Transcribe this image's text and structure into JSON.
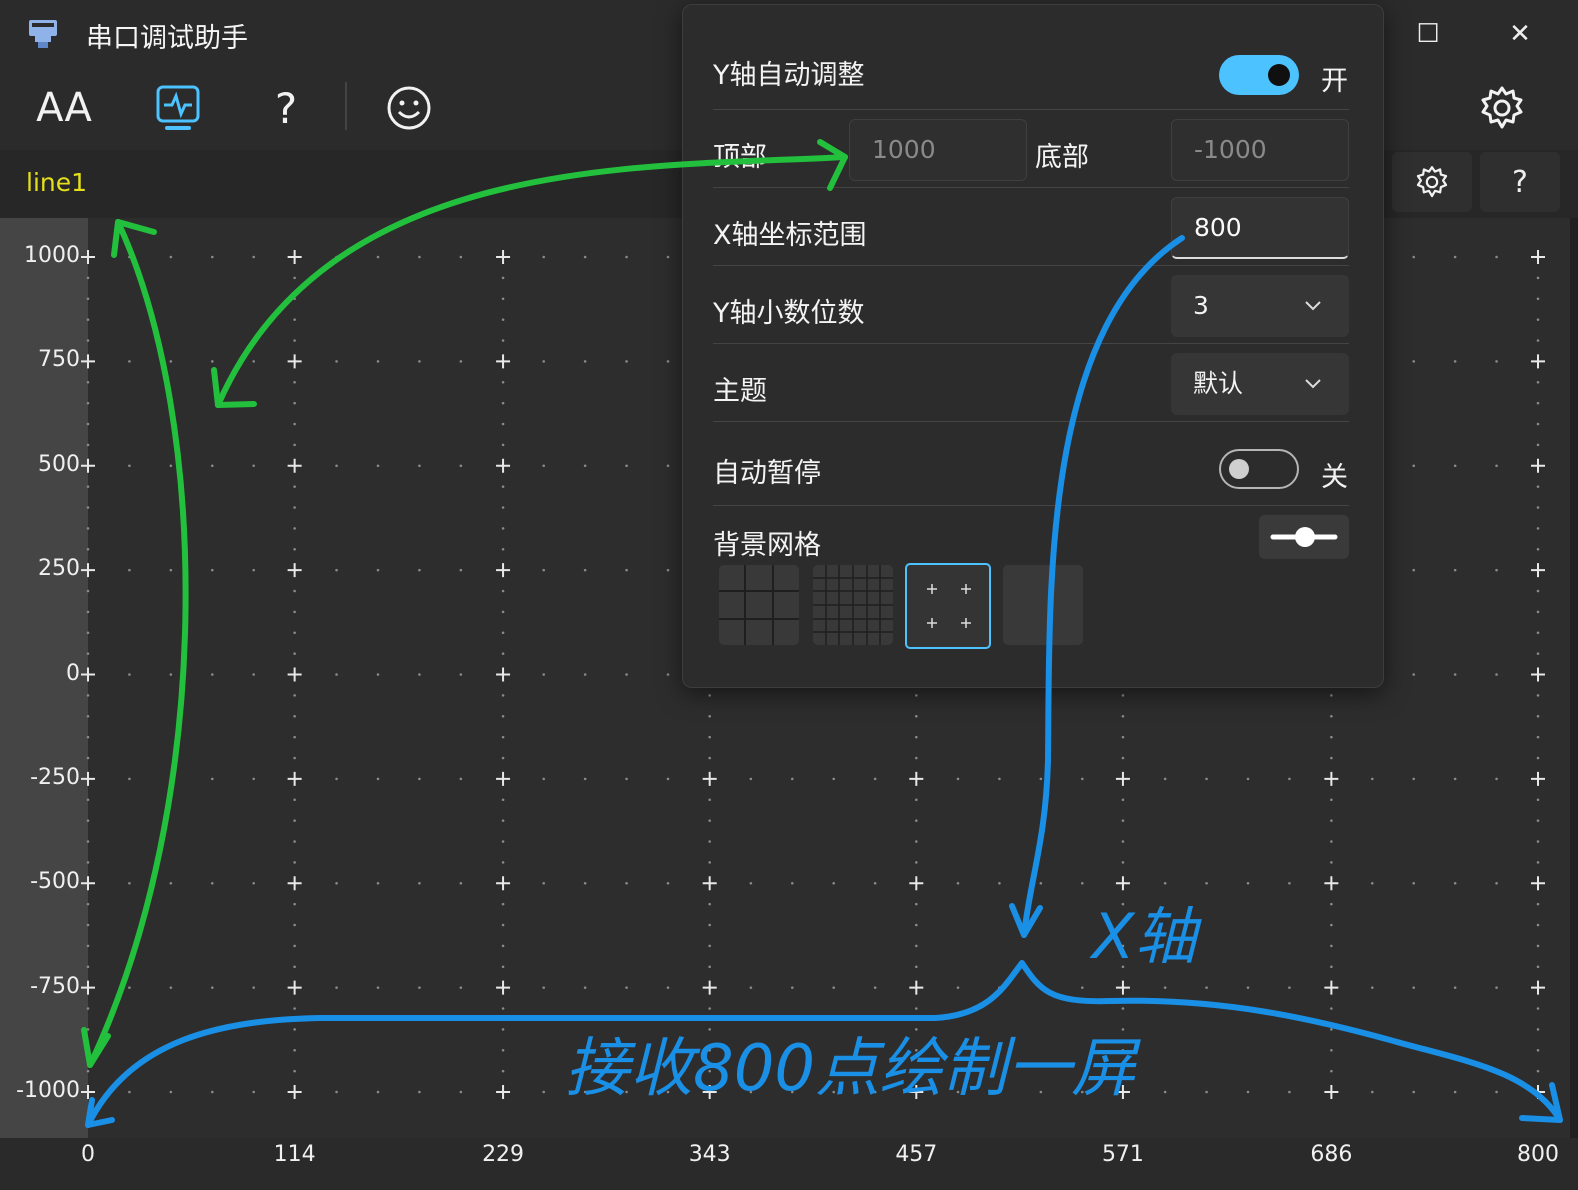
{
  "app": {
    "title": "串口调试助手"
  },
  "window_controls": {
    "minimize": "—",
    "maximize": "☐",
    "close": "✕"
  },
  "toolbar": {
    "font_size_label": "AA",
    "help_label": "?"
  },
  "legend": {
    "series": [
      "line1"
    ]
  },
  "plot_buttons": {
    "settings_icon": "gear-icon",
    "help_label": "?"
  },
  "settings_panel": {
    "y_auto": {
      "label": "Y轴自动调整",
      "state": true,
      "state_text": "开"
    },
    "top_label": "顶部",
    "top_value": "1000",
    "bottom_label": "底部",
    "bottom_value": "-1000",
    "x_range": {
      "label": "X轴坐标范围",
      "value": "800"
    },
    "y_decimals": {
      "label": "Y轴小数位数",
      "value": "3"
    },
    "theme": {
      "label": "主题",
      "value": "默认"
    },
    "auto_pause": {
      "label": "自动暂停",
      "state": false,
      "state_text": "关"
    },
    "bg_grid": {
      "label": "背景网格",
      "options": [
        "lines",
        "fine-lines",
        "crosses",
        "none"
      ],
      "selected": 2
    }
  },
  "chart_data": {
    "type": "line",
    "series": [
      {
        "name": "line1",
        "values": []
      }
    ],
    "y_ticks": [
      "1000",
      "750",
      "500",
      "250",
      "0",
      "-250",
      "-500",
      "-750",
      "-1000"
    ],
    "x_ticks": [
      "0",
      "114",
      "229",
      "343",
      "457",
      "571",
      "686",
      "800"
    ],
    "xlim": [
      0,
      800
    ],
    "ylim": [
      -1000,
      1000
    ],
    "grid": "crosses"
  },
  "annotations": {
    "x_axis_note": "X轴",
    "receive_note": "接收800点绘制一屏"
  },
  "colors": {
    "accent": "#4cc2ff",
    "series_line1": "#e5df1b",
    "annot_green": "#22c03c",
    "annot_blue": "#1a8fe6"
  }
}
